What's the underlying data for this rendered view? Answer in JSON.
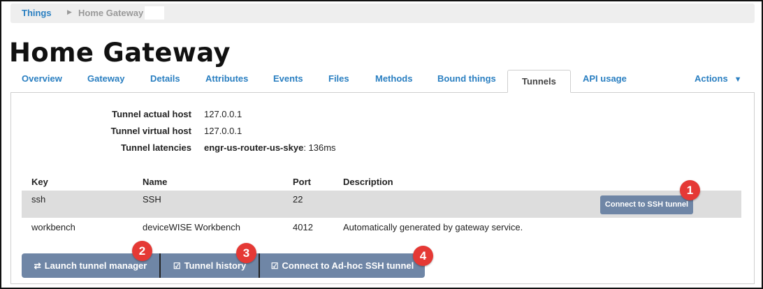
{
  "breadcrumb": {
    "root": "Things",
    "separator": "▶",
    "current": "Home Gateway"
  },
  "page_title": "Home Gateway",
  "tabs": [
    {
      "label": "Overview",
      "active": false
    },
    {
      "label": "Gateway",
      "active": false
    },
    {
      "label": "Details",
      "active": false
    },
    {
      "label": "Attributes",
      "active": false
    },
    {
      "label": "Events",
      "active": false
    },
    {
      "label": "Files",
      "active": false
    },
    {
      "label": "Methods",
      "active": false
    },
    {
      "label": "Bound things",
      "active": false
    },
    {
      "label": "Tunnels",
      "active": true
    },
    {
      "label": "API usage",
      "active": false
    }
  ],
  "actions_menu": {
    "label": "Actions",
    "icon": "caret-down-icon"
  },
  "tunnel_info": {
    "actual_host_label": "Tunnel actual host",
    "actual_host_value": "127.0.0.1",
    "virtual_host_label": "Tunnel virtual host",
    "virtual_host_value": "127.0.0.1",
    "latencies_label": "Tunnel latencies",
    "latencies_host": "engr-us-router-us-skye",
    "latencies_value": ": 136ms"
  },
  "tunnels_table": {
    "headers": {
      "key": "Key",
      "name": "Name",
      "port": "Port",
      "description": "Description"
    },
    "rows": [
      {
        "key": "ssh",
        "name": "SSH",
        "port": "22",
        "description": "",
        "action_label": "Connect to SSH tunnel"
      },
      {
        "key": "workbench",
        "name": "deviceWISE Workbench",
        "port": "4012",
        "description": "Automatically generated by gateway service."
      }
    ]
  },
  "bottom_buttons": {
    "launch": {
      "icon": "⇄",
      "label": "Launch tunnel manager"
    },
    "history": {
      "icon": "☑",
      "label": "Tunnel history"
    },
    "adhoc": {
      "icon": "☑",
      "label": "Connect to Ad-hoc SSH tunnel"
    }
  },
  "callouts": [
    "1",
    "2",
    "3",
    "4"
  ],
  "colors": {
    "link": "#2a7fc1",
    "button": "#6f86a6",
    "callout": "#e53935",
    "row_highlight": "#dddddd"
  }
}
